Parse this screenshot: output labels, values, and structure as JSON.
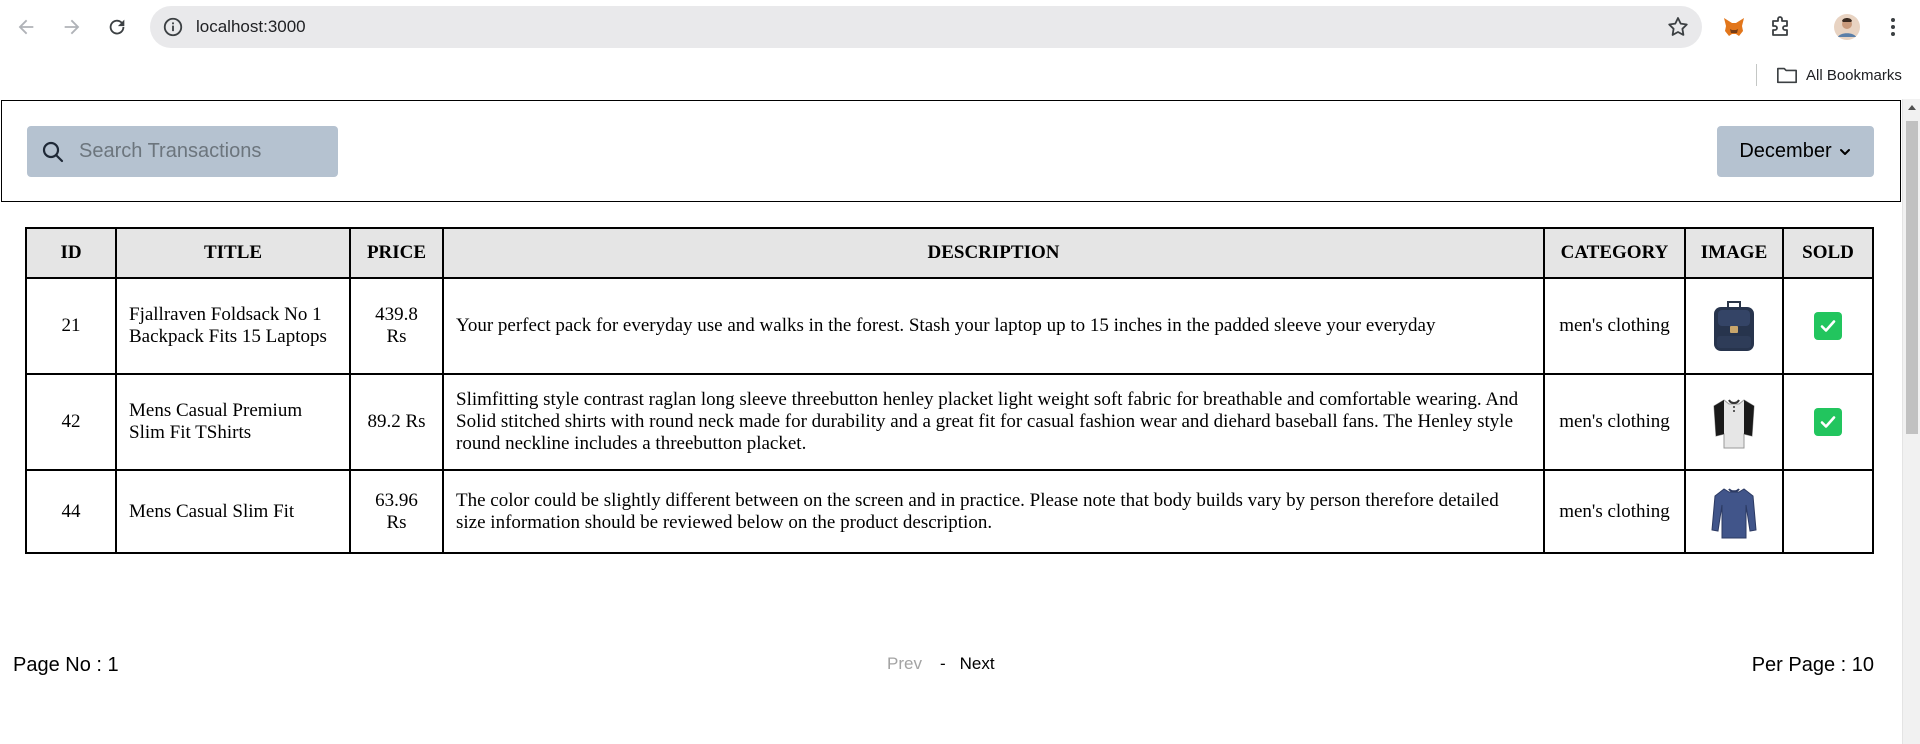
{
  "browser": {
    "url": "localhost:3000",
    "bookmarks_label": "All Bookmarks"
  },
  "header": {
    "search_placeholder": "Search Transactions",
    "month": "December"
  },
  "table": {
    "columns": [
      "ID",
      "TITLE",
      "PRICE",
      "DESCRIPTION",
      "CATEGORY",
      "IMAGE",
      "SOLD"
    ],
    "rows": [
      {
        "id": "21",
        "title": "Fjallraven Foldsack No 1 Backpack Fits 15 Laptops",
        "price": "439.8 Rs",
        "description": "Your perfect pack for everyday use and walks in the forest. Stash your laptop up to 15 inches in the padded sleeve your everyday",
        "category": "men's clothing",
        "image": "backpack-image",
        "sold": true
      },
      {
        "id": "42",
        "title": "Mens Casual Premium Slim Fit TShirts",
        "price": "89.2 Rs",
        "description": "Slimfitting style contrast raglan long sleeve threebutton henley placket light weight soft fabric for breathable and comfortable wearing. And Solid stitched shirts with round neck made for durability and a great fit for casual fashion wear and diehard baseball fans. The Henley style round neckline includes a threebutton placket.",
        "category": "men's clothing",
        "image": "tshirt-image",
        "sold": true
      },
      {
        "id": "44",
        "title": "Mens Casual Slim Fit",
        "price": "63.96 Rs",
        "description": "The color could be slightly different between on the screen and in practice. Please note that body builds vary by person therefore detailed size information should be reviewed below on the product description.",
        "category": "men's clothing",
        "image": "longsleeve-image",
        "sold": false
      }
    ]
  },
  "footer": {
    "page_no": "Page No : 1",
    "prev": "Prev",
    "separator": "-",
    "next": "Next",
    "per_page": "Per Page : 10"
  },
  "colors": {
    "control_bg": "#b5c2d0",
    "header_bg": "#e5e5e5",
    "sold_check": "#22c55e",
    "prev_disabled": "#a3a3a3"
  }
}
